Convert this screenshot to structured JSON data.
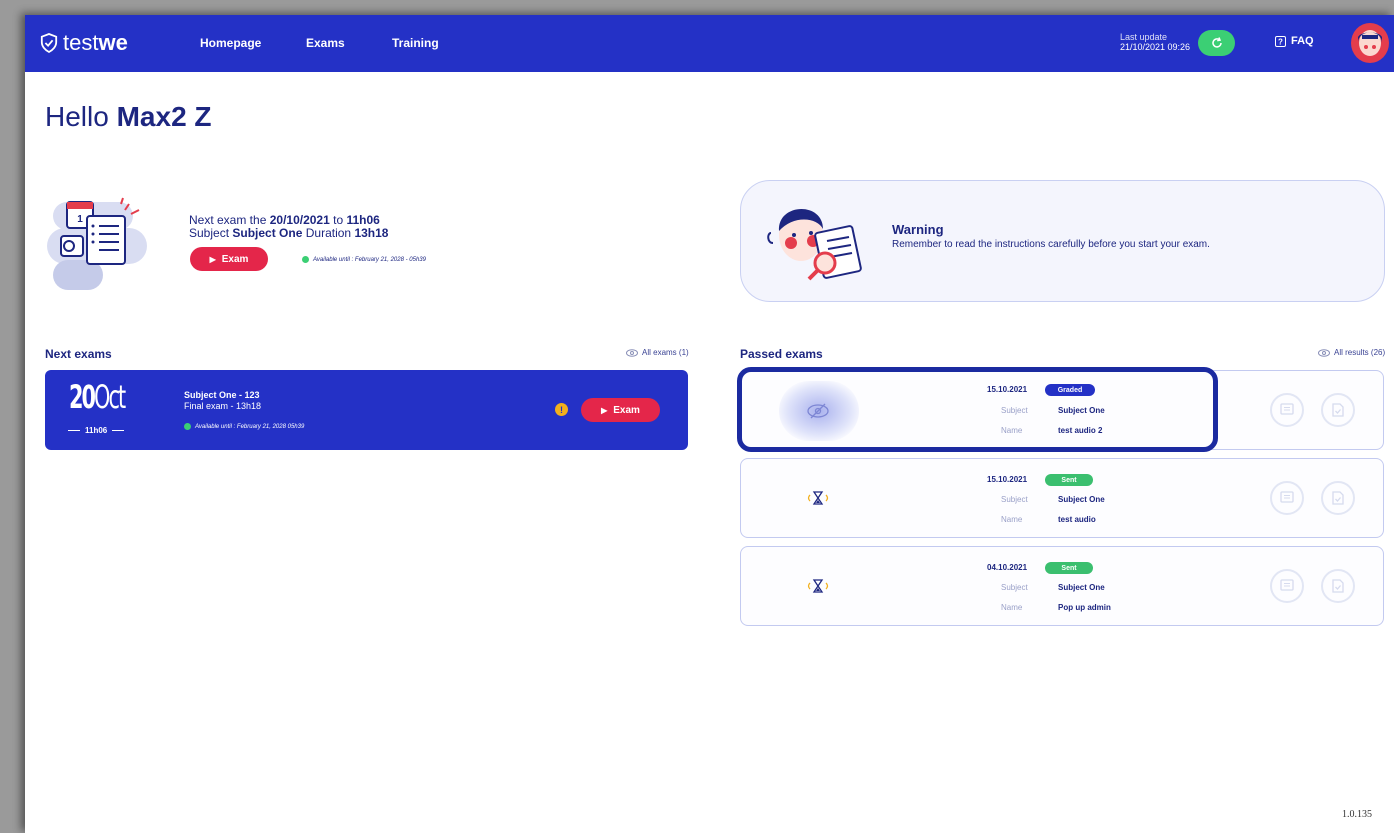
{
  "header": {
    "logo_light": "test",
    "logo_bold": "we",
    "nav": [
      "Homepage",
      "Exams",
      "Training"
    ],
    "last_update_label": "Last update",
    "last_update_value": "21/10/2021 09:26",
    "faq_label": "FAQ"
  },
  "greeting": {
    "hello": "Hello",
    "name": "Max2 Z"
  },
  "next_exam_banner": {
    "line1_prefix": "Next exam the",
    "line1_date": "20/10/2021",
    "line1_to": "to",
    "line1_time": "11h06",
    "line2_subject_label": "Subject",
    "line2_subject": "Subject One",
    "line2_duration_label": "Duration",
    "line2_duration": "13h18",
    "exam_button": "Exam",
    "available": "Available until : February 21, 2028 - 05h39"
  },
  "warning": {
    "title": "Warning",
    "text": "Remember to read the instructions carefully before you start your exam."
  },
  "next_exams": {
    "title": "Next exams",
    "link": "All exams (1)",
    "card": {
      "day": "20",
      "month": "Oct",
      "time": "11h06",
      "subject": "Subject One - 123",
      "name": "Final exam - 13h18",
      "available": "Available until : February 21, 2028 05h39",
      "info": "!",
      "exam_button": "Exam"
    }
  },
  "passed_exams": {
    "title": "Passed exams",
    "link": "All results (26)",
    "subject_label": "Subject",
    "name_label": "Name",
    "items": [
      {
        "date": "15.10.2021",
        "status": "Graded",
        "status_color": "#2431c6",
        "subject": "Subject One",
        "name": "test audio 2"
      },
      {
        "date": "15.10.2021",
        "status": "Sent",
        "status_color": "#3bbf6f",
        "subject": "Subject One",
        "name": "test audio"
      },
      {
        "date": "04.10.2021",
        "status": "Sent",
        "status_color": "#3bbf6f",
        "subject": "Subject One",
        "name": "Pop up admin"
      }
    ]
  },
  "version": "1.0.135"
}
